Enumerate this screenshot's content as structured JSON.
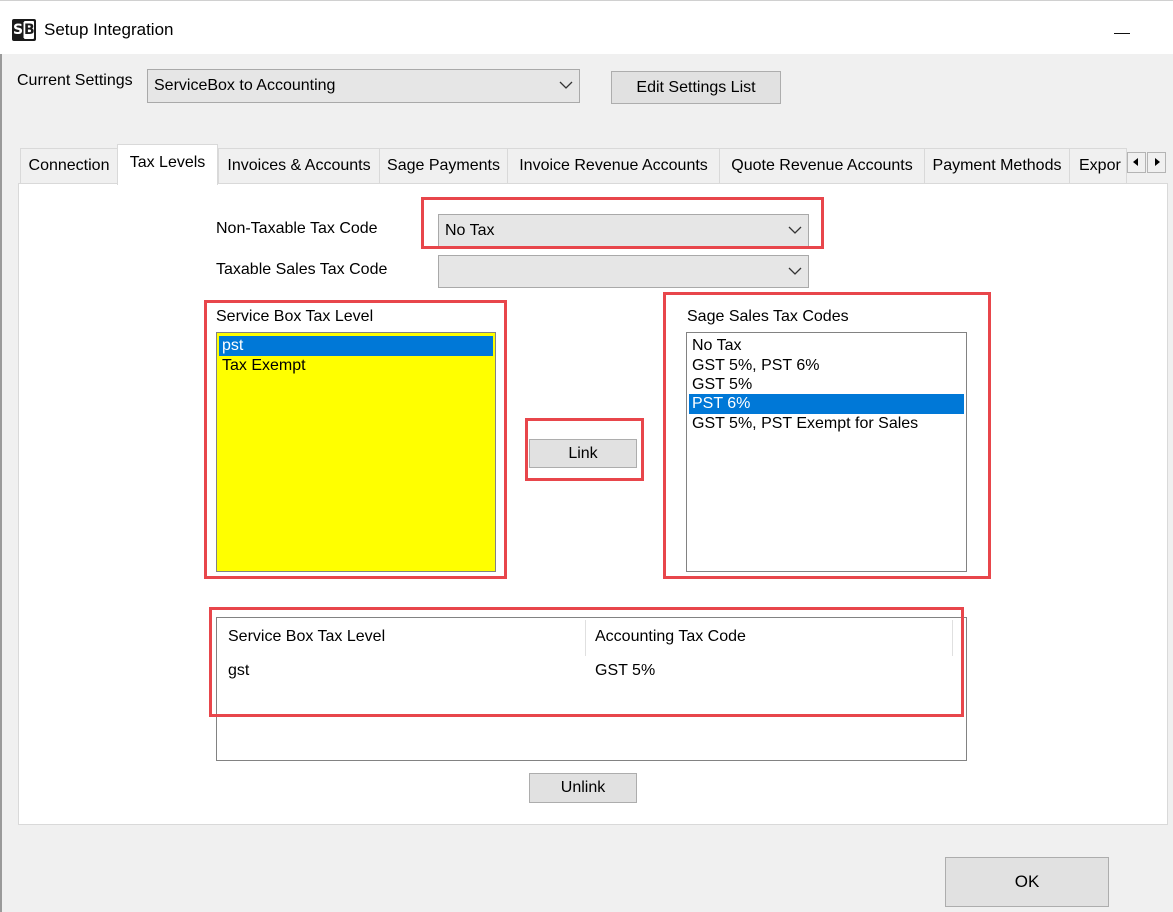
{
  "window": {
    "title": "Setup Integration",
    "app_icon": [
      "S",
      "B"
    ],
    "icon": "sb-app-icon"
  },
  "current_settings": {
    "label": "Current Settings",
    "selected": "ServiceBox to Accounting",
    "edit_button": "Edit Settings List"
  },
  "tabs": [
    {
      "label": "Connection",
      "active": false
    },
    {
      "label": "Tax Levels",
      "active": true
    },
    {
      "label": "Invoices & Accounts",
      "active": false
    },
    {
      "label": "Sage Payments",
      "active": false
    },
    {
      "label": "Invoice Revenue Accounts",
      "active": false
    },
    {
      "label": "Quote Revenue Accounts",
      "active": false
    },
    {
      "label": "Payment Methods",
      "active": false
    },
    {
      "label": "Expor",
      "active": false
    }
  ],
  "tax_levels": {
    "non_taxable_label": "Non-Taxable Tax Code",
    "non_taxable_value": "No Tax",
    "taxable_label": "Taxable Sales Tax Code",
    "taxable_value": "",
    "service_box_label": "Service Box Tax Level",
    "service_box_items": [
      {
        "text": "pst",
        "selected": true
      },
      {
        "text": "Tax Exempt",
        "selected": false
      }
    ],
    "sage_label": "Sage Sales Tax Codes",
    "sage_items": [
      {
        "text": "No Tax",
        "selected": false
      },
      {
        "text": "GST 5%, PST 6%",
        "selected": false
      },
      {
        "text": "GST 5%",
        "selected": false
      },
      {
        "text": "PST 6%",
        "selected": true
      },
      {
        "text": "GST 5%, PST Exempt for Sales",
        "selected": false
      }
    ],
    "link_button": "Link",
    "grid": {
      "columns": [
        "Service Box Tax Level",
        "Accounting Tax Code"
      ],
      "rows": [
        [
          "gst",
          "GST 5%"
        ]
      ]
    },
    "unlink_button": "Unlink"
  },
  "ok_button": "OK",
  "colors": {
    "annotation": "#e8464b",
    "selection": "#0078d7",
    "list_highlight": "#ffff00"
  }
}
